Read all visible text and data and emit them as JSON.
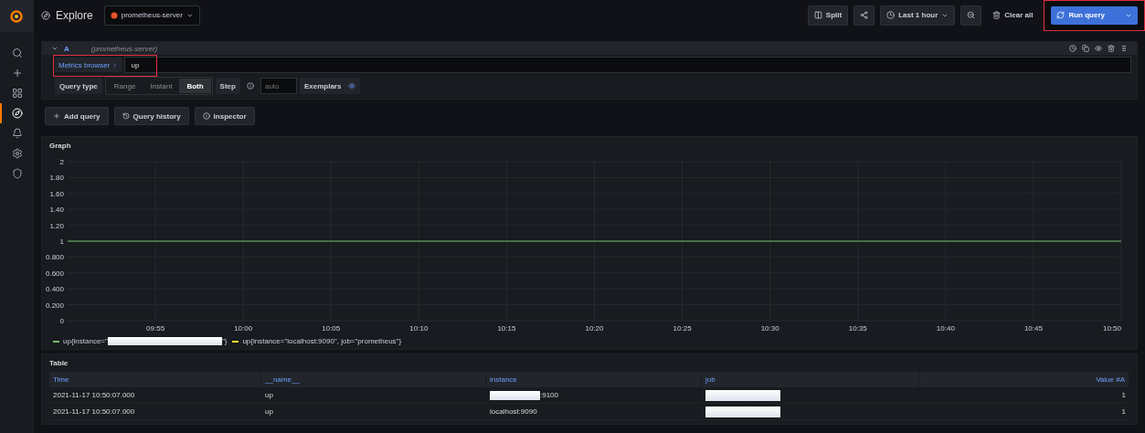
{
  "sidebar": {
    "items": [
      {
        "selected": false
      },
      {
        "selected": false
      },
      {
        "selected": false
      },
      {
        "selected": true
      },
      {
        "selected": false
      },
      {
        "selected": false
      },
      {
        "selected": false
      }
    ]
  },
  "toolbar": {
    "title": "Explore",
    "datasource": "prometheus-server",
    "split": "Split",
    "time_range": "Last 1 hour",
    "clear": "Clear all",
    "run": {
      "label": "Run query",
      "highlighted": true
    }
  },
  "query": {
    "ref": "A",
    "datasource": "(prometheus-server)",
    "metrics_browser": {
      "label": "Metrics browser",
      "highlighted": true
    },
    "expression": "up",
    "query_type_label": "Query type",
    "query_types": [
      {
        "label": "Range",
        "selected": false
      },
      {
        "label": "Instant",
        "selected": false
      },
      {
        "label": "Both",
        "selected": true
      }
    ],
    "step_label": "Step",
    "step_placeholder": "auto",
    "exemplars_label": "Exemplars",
    "exemplars_on": true
  },
  "actions": [
    "Add query",
    "Query history",
    "Inspector"
  ],
  "graph": {
    "title": "Graph",
    "chart_data": {
      "type": "line",
      "ylim": [
        0,
        2
      ],
      "yticks": [
        {
          "value": 0,
          "label": "0"
        },
        {
          "value": 0.2,
          "label": "0.200"
        },
        {
          "value": 0.4,
          "label": "0.400"
        },
        {
          "value": 0.6,
          "label": "0.600"
        },
        {
          "value": 0.8,
          "label": "0.800"
        },
        {
          "value": 1,
          "label": "1"
        },
        {
          "value": 1.2,
          "label": "1.20"
        },
        {
          "value": 1.4,
          "label": "1.40"
        },
        {
          "value": 1.6,
          "label": "1.60"
        },
        {
          "value": 1.8,
          "label": "1.80"
        },
        {
          "value": 2,
          "label": "2"
        }
      ],
      "categories": [
        null,
        "09:55",
        "10:00",
        "10:05",
        "10:10",
        "10:15",
        "10:20",
        "10:25",
        "10:30",
        "10:35",
        "10:40",
        "10:45",
        "10:50"
      ],
      "grid": true,
      "series": [
        {
          "color": "#73bf69",
          "values": [
            1,
            1,
            1,
            1,
            1,
            1,
            1,
            1,
            1,
            1,
            1,
            1,
            1
          ]
        }
      ]
    },
    "legend": [
      {
        "color": "#73bf69",
        "before": "up{instance=\"",
        "after": "\"}",
        "redacted": true
      },
      {
        "color": "#fade2a",
        "before": "up{instance=\"localhost:9090\", job=\"prometheus\"}",
        "redacted": false
      }
    ]
  },
  "table": {
    "title": "Table",
    "columns": [
      "Time",
      "__name__",
      "instance",
      "job",
      "Value #A"
    ],
    "rows": [
      [
        {
          "text": "2021-11-17 10:50:07.000",
          "redacted": false
        },
        {
          "text": "up",
          "redacted": false
        },
        {
          "text": ":9100",
          "redacted": true
        },
        {
          "redacted": true
        },
        {
          "text": "1",
          "redacted": false
        }
      ],
      [
        {
          "text": "2021-11-17 10:50:07.000",
          "redacted": false
        },
        {
          "text": "up",
          "redacted": false
        },
        {
          "text": "localhost:9090",
          "redacted": false
        },
        {
          "redacted": true
        },
        {
          "text": "1",
          "redacted": false
        }
      ]
    ]
  }
}
